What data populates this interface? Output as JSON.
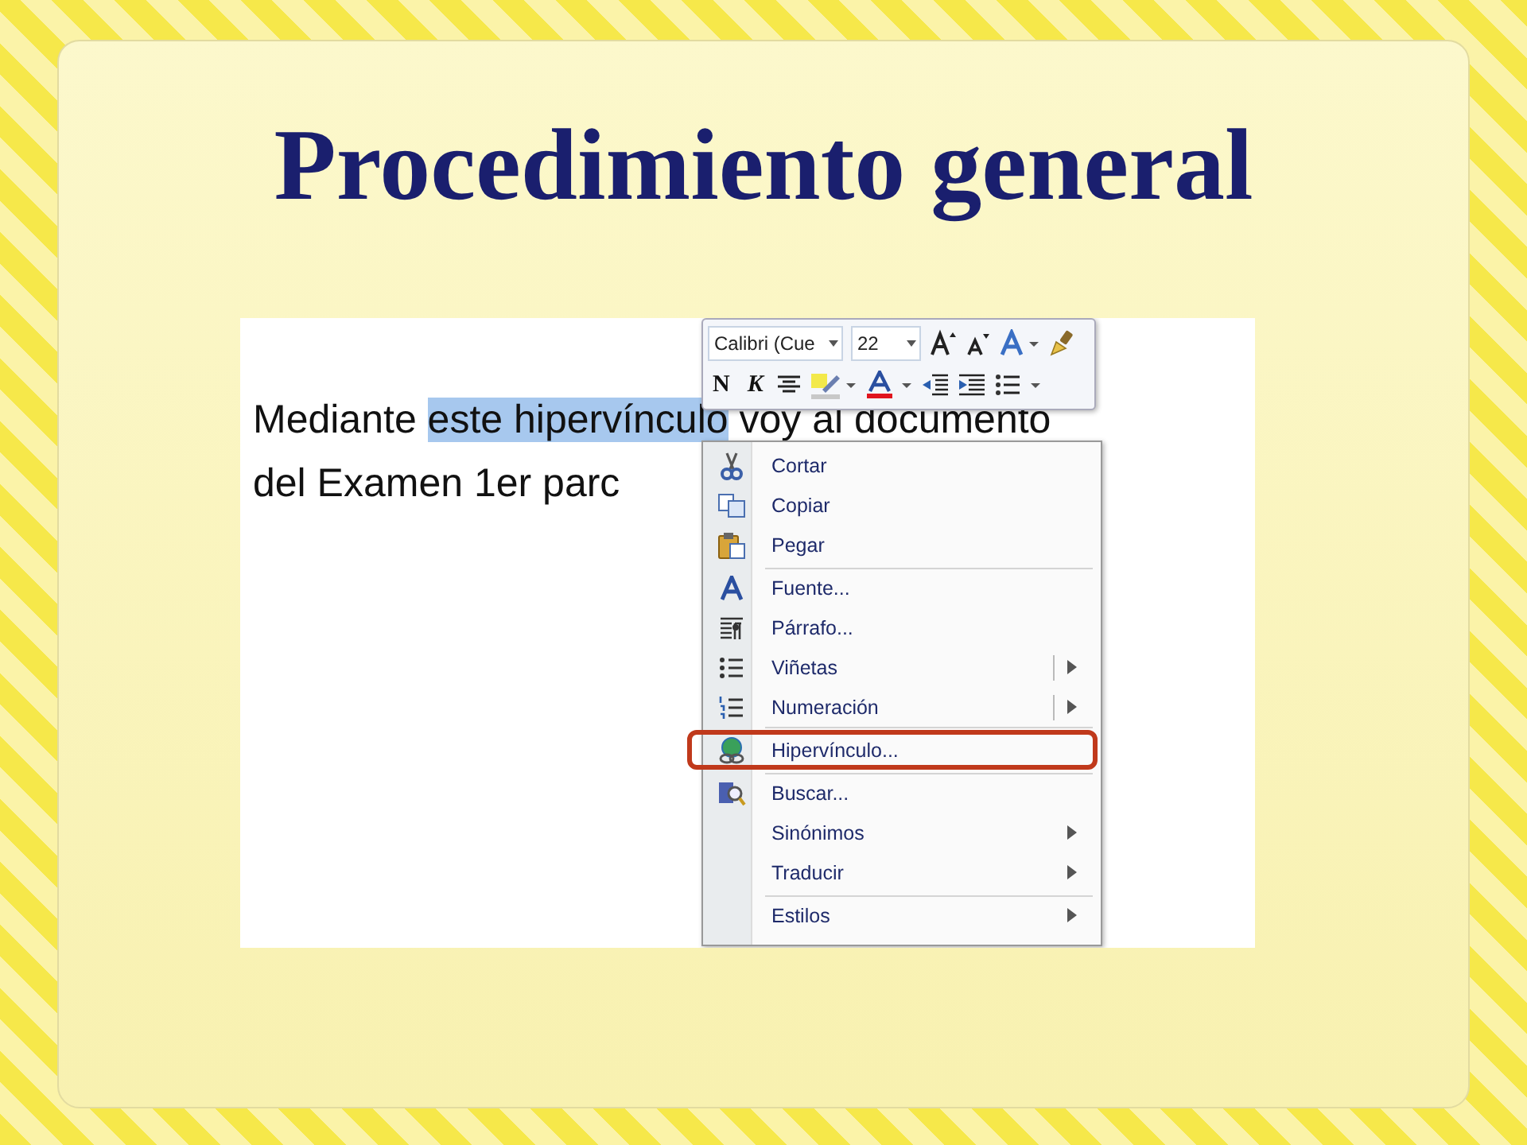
{
  "slide": {
    "title": "Procedimiento general"
  },
  "document": {
    "lines": [
      {
        "before": "Mediante ",
        "selection": "este hipervínculo",
        "after": " voy al documento"
      },
      {
        "before": "del Examen 1er parc"
      }
    ]
  },
  "mini_toolbar": {
    "font": "Calibri (Cue",
    "size": "22",
    "bold": "N",
    "italic": "K"
  },
  "context_menu": [
    {
      "label": "Cortar",
      "separator_before": false,
      "submenu": false,
      "split": false,
      "highlighted": false
    },
    {
      "label": "Copiar",
      "separator_before": false,
      "submenu": false,
      "split": false,
      "highlighted": false
    },
    {
      "label": "Pegar",
      "separator_before": false,
      "submenu": false,
      "split": false,
      "highlighted": false
    },
    {
      "label": "Fuente...",
      "separator_before": true,
      "submenu": false,
      "split": false,
      "highlighted": false
    },
    {
      "label": "Párrafo...",
      "separator_before": false,
      "submenu": false,
      "split": false,
      "highlighted": false
    },
    {
      "label": "Viñetas",
      "separator_before": false,
      "submenu": true,
      "split": true,
      "highlighted": false
    },
    {
      "label": "Numeración",
      "separator_before": false,
      "submenu": true,
      "split": true,
      "highlighted": false
    },
    {
      "label": "Hipervínculo...",
      "separator_before": true,
      "submenu": false,
      "split": false,
      "highlighted": true
    },
    {
      "label": "Buscar...",
      "separator_before": true,
      "submenu": false,
      "split": false,
      "highlighted": false
    },
    {
      "label": "Sinónimos",
      "separator_before": false,
      "submenu": true,
      "split": false,
      "highlighted": false
    },
    {
      "label": "Traducir",
      "separator_before": false,
      "submenu": true,
      "split": false,
      "highlighted": false
    },
    {
      "label": "Estilos",
      "separator_before": true,
      "submenu": true,
      "split": false,
      "highlighted": false
    }
  ]
}
